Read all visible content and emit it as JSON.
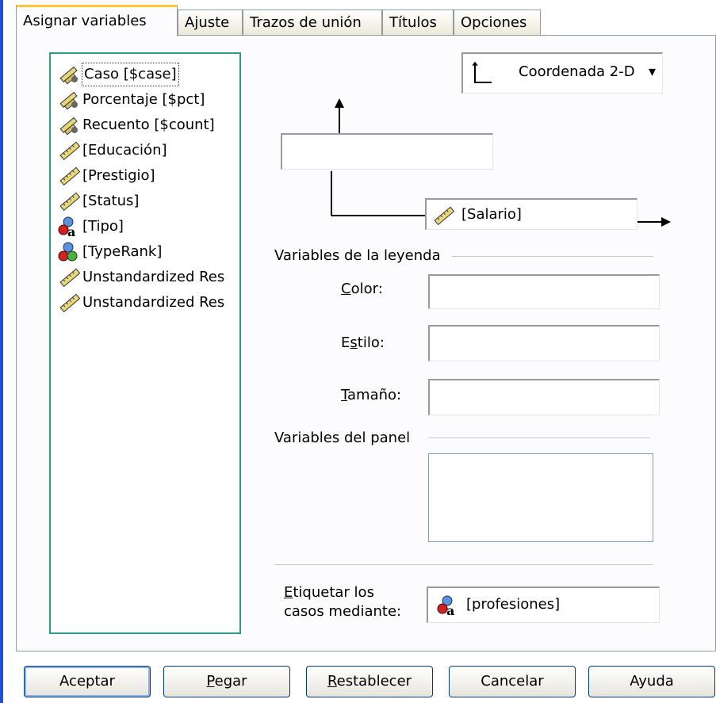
{
  "tabs": [
    {
      "label": "Asignar variables",
      "active": true
    },
    {
      "label": "Ajuste"
    },
    {
      "label": "Trazos de unión"
    },
    {
      "label": "Títulos"
    },
    {
      "label": "Opciones"
    }
  ],
  "variables": [
    {
      "label": "Caso [$case]",
      "icon": "scale-group-icon",
      "selected": true
    },
    {
      "label": "Porcentaje [$pct]",
      "icon": "scale-group-icon"
    },
    {
      "label": "Recuento [$count]",
      "icon": "scale-group-icon"
    },
    {
      "label": "[Educación]",
      "icon": "ruler-icon"
    },
    {
      "label": "[Prestigio]",
      "icon": "ruler-icon"
    },
    {
      "label": "[Status]",
      "icon": "ruler-icon"
    },
    {
      "label": "[Tipo]",
      "icon": "nominal-icon"
    },
    {
      "label": "[TypeRank]",
      "icon": "ordinal-icon"
    },
    {
      "label": "Unstandardized Res",
      "icon": "ruler-icon"
    },
    {
      "label": "Unstandardized Res",
      "icon": "ruler-icon"
    }
  ],
  "coordinate_dropdown": {
    "label": "Coordenada 2-D"
  },
  "y_axis_field": {
    "value": ""
  },
  "x_axis_field": {
    "value": "[Salario]"
  },
  "legend": {
    "title": "Variables de la leyenda",
    "color_label": {
      "accel": "C",
      "rest": "olor:"
    },
    "style_label": {
      "pre": "E",
      "accel": "s",
      "rest": "tilo:"
    },
    "size_label": {
      "accel": "T",
      "rest": "amaño:"
    }
  },
  "panel": {
    "title": "Variables del panel"
  },
  "label_cases": {
    "line1_accel": "E",
    "line1_rest": "tiquetar los",
    "line2": "casos mediante:",
    "value": "[profesiones]"
  },
  "buttons": {
    "ok": "Aceptar",
    "paste_accel": "P",
    "paste_rest": "egar",
    "reset_accel": "R",
    "reset_rest": "establecer",
    "cancel": "Cancelar",
    "help": "Ayuda"
  },
  "colors": {
    "list_border": "#2f9a8a",
    "tab_highlight": "#ffc83c",
    "left_accent": "#1f4fd8"
  }
}
